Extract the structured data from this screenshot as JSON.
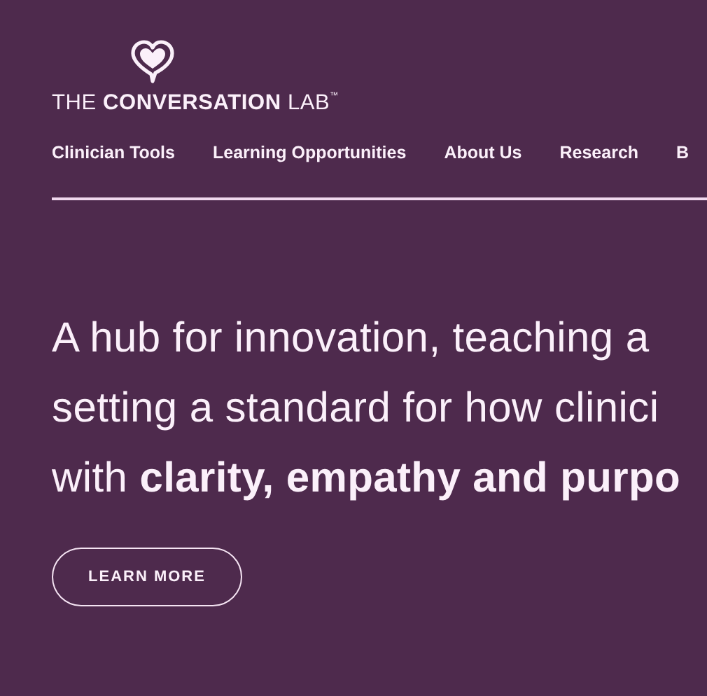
{
  "logo": {
    "wordmark": "THE **CONVERSATION** LAB$^{™}$"
  },
  "nav": [
    {
      "label": "Clinician Tools"
    },
    {
      "label": "Learning Opportunities"
    },
    {
      "label": "About Us"
    },
    {
      "label": "Research"
    },
    {
      "label": "B"
    }
  ],
  "hero": {
    "lines": [
      "A hub for innovation, teaching a",
      "setting a standard for how clinici",
      "with **clarity, empathy and purpo**"
    ],
    "button": "LEARN MORE"
  }
}
